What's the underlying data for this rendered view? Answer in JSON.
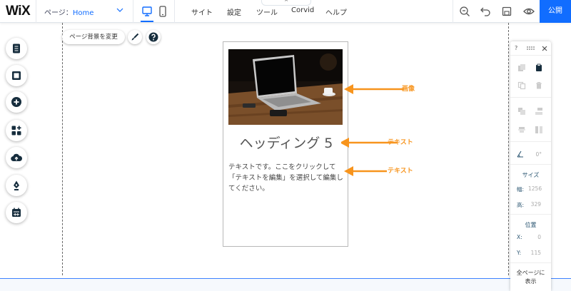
{
  "brand": {
    "logo": "WiX"
  },
  "page_selector": {
    "label": "ページ：",
    "value": "Home"
  },
  "menu": [
    "サイト",
    "設定",
    "ツール",
    "Corvid",
    "ヘルプ"
  ],
  "tab_notch": "^",
  "publish_label": "公開",
  "canvas": {
    "bg_button": "ページ背景を変更",
    "heading": "ヘッディング 5",
    "body_text": "テキストです。ここをクリックして「テキストを編集」を選択して編集してください。"
  },
  "annotations": {
    "image": "画像",
    "text1": "テキスト",
    "text2": "テキスト"
  },
  "right_panel": {
    "help": "?",
    "angle": "0°",
    "size_title": "サイズ",
    "width_label": "幅:",
    "width_value": "1256",
    "height_label": "高:",
    "height_value": "329",
    "position_title": "位置",
    "x_label": "X:",
    "x_value": "0",
    "y_label": "Y:",
    "y_value": "115",
    "show_all_line1": "全ページに",
    "show_all_line2": "表示"
  },
  "colors": {
    "accent": "#116dff",
    "annotation": "#f7941d"
  }
}
